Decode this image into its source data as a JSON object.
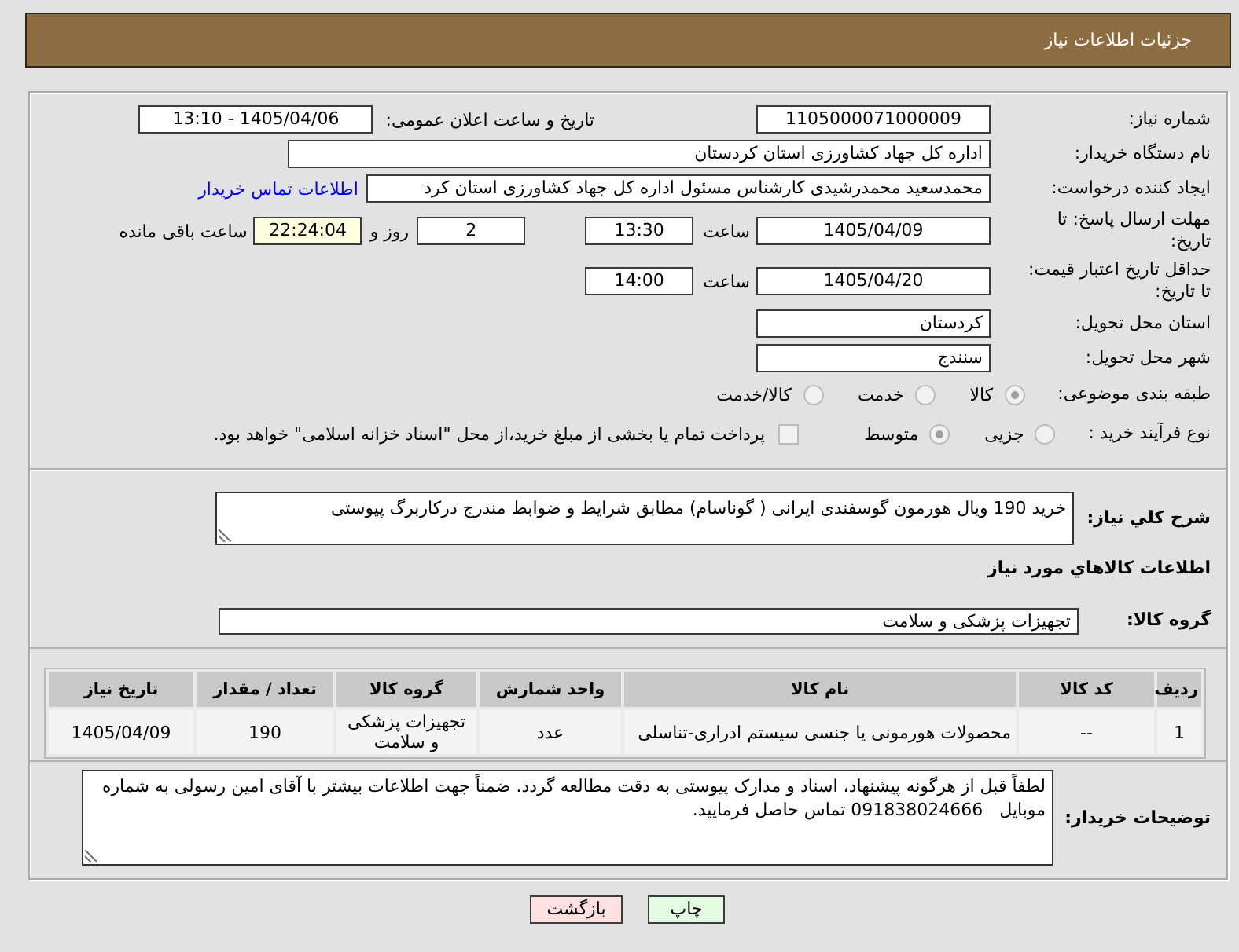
{
  "header": {
    "title": "جزئیات اطلاعات نیاز"
  },
  "need_number": {
    "label": "شماره نیاز:",
    "value": "1105000071000009"
  },
  "announcement": {
    "label": "تاریخ و ساعت اعلان عمومی:",
    "value": "1405/04/06 - 13:10"
  },
  "buyer_org": {
    "label": "نام دستگاه خریدار:",
    "value": "اداره کل جهاد کشاورزی استان کردستان"
  },
  "requester": {
    "label": "ایجاد کننده درخواست:",
    "value": "محمدسعید محمدرشیدی کارشناس مسئول اداره کل جهاد کشاورزی استان کرد",
    "link": "اطلاعات تماس خریدار"
  },
  "response_deadline": {
    "label": "مهلت ارسال پاسخ: تا تاریخ:",
    "date": "1405/04/09",
    "time_label": "ساعت",
    "time": "13:30",
    "days": "2",
    "days_label": "روز و",
    "remaining": "22:24:04",
    "remaining_label": "ساعت باقی مانده"
  },
  "price_validity": {
    "label": "حداقل تاریخ اعتبار قیمت: تا تاریخ:",
    "date": "1405/04/20",
    "time_label": "ساعت",
    "time": "14:00"
  },
  "delivery_province": {
    "label": "استان محل تحویل:",
    "value": "کردستان"
  },
  "delivery_city": {
    "label": "شهر محل تحویل:",
    "value": "سنندج"
  },
  "subject_category": {
    "label": "طبقه بندی موضوعی:",
    "options": [
      {
        "label": "کالا",
        "selected": true
      },
      {
        "label": "خدمت",
        "selected": false
      },
      {
        "label": "کالا/خدمت",
        "selected": false
      }
    ]
  },
  "purchase_process": {
    "label": "نوع فرآیند خرید :",
    "options": [
      {
        "label": "جزیی",
        "selected": false
      },
      {
        "label": "متوسط",
        "selected": true
      }
    ],
    "treasury_payment": {
      "label": "پرداخت تمام یا بخشی از مبلغ خرید،از محل \"اسناد خزانه اسلامی\" خواهد بود.",
      "checked": false
    }
  },
  "description": {
    "label": "شرح کلي نیاز:",
    "value": "خرید 190 ویال هورمون گوسفندی ایرانی ( گوناسام) مطابق شرایط و ضوابط مندرج درکاربرگ پیوستی"
  },
  "goods_heading": "اطلاعات کالاهاي مورد نیاز",
  "goods_group": {
    "label": "گروه کالا:",
    "value": "تجهیزات پزشکی و سلامت"
  },
  "table": {
    "columns": [
      "ردیف",
      "کد کالا",
      "نام کالا",
      "واحد شمارش",
      "گروه کالا",
      "تعداد / مقدار",
      "تاریخ نیاز"
    ],
    "rows": [
      [
        "1",
        "--",
        "محصولات هورمونی یا جنسی سیستم ادراری-تناسلی",
        "عدد",
        "تجهیزات پزشکی و سلامت",
        "190",
        "1405/04/09"
      ]
    ]
  },
  "buyer_notes": {
    "label": "توضیحات خریدار:",
    "value": "لطفاً قبل از هرگونه پیشنهاد، اسناد و مدارک پیوستی به دقت مطالعه گردد. ضمناً جهت اطلاعات بیشتر با آقای امین رسولی به شماره موبایل   091838024666 تماس حاصل فرمایید."
  },
  "buttons": [
    {
      "label": "چاپ",
      "kind": "print"
    },
    {
      "label": "بازگشت",
      "kind": "back"
    }
  ]
}
